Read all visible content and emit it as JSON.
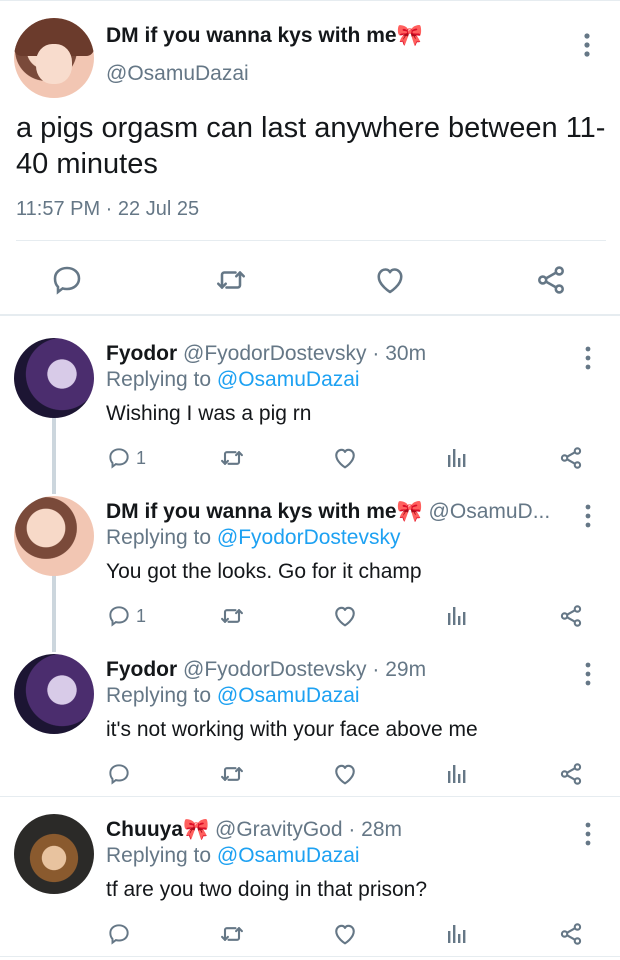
{
  "main_tweet": {
    "display_name": "DM if you wanna kys with me",
    "name_emoji": "🎀",
    "handle": "@OsamuDazai",
    "text": "a pigs orgasm can last anywhere between 11-40 minutes",
    "timestamp": "11:57 PM · 22 Jul 25",
    "icons": [
      "comment-icon",
      "retweet-icon",
      "like-icon",
      "share-icon"
    ]
  },
  "replies": [
    {
      "display_name": "Fyodor",
      "handle_time": "@FyodorDostevsky · 30m",
      "replying_prefix": "Replying to ",
      "replying_to": "@OsamuDazai",
      "text": "Wishing I was a pig rn",
      "reply_count": "1"
    },
    {
      "display_name": "DM if you wanna kys with me🎀",
      "handle_time": "@OsamuD...",
      "replying_prefix": "Replying to ",
      "replying_to": "@FyodorDostevsky",
      "text": "You got the looks. Go for it champ",
      "reply_count": "1"
    },
    {
      "display_name": "Fyodor",
      "handle_time": "@FyodorDostevsky · 29m",
      "replying_prefix": "Replying to ",
      "replying_to": "@OsamuDazai",
      "text": "it's not working with your face above me",
      "reply_count": ""
    },
    {
      "display_name": "Chuuya🎀",
      "handle_time": "@GravityGod · 28m",
      "replying_prefix": "Replying to ",
      "replying_to": "@OsamuDazai",
      "text": "tf are you two doing in that prison?",
      "reply_count": ""
    }
  ],
  "colors": {
    "link": "#1da1f2",
    "secondary_text": "#657786",
    "divider": "#e6ecf0",
    "icon": "#657786"
  }
}
